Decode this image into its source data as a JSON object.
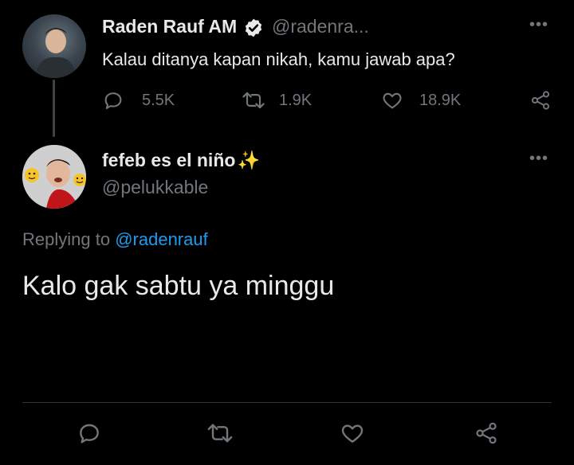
{
  "parent_tweet": {
    "display_name": "Raden Rauf AM",
    "handle": "@radenra...",
    "text": "Kalau ditanya kapan nikah, kamu jawab apa?",
    "replies": "5.5K",
    "retweets": "1.9K",
    "likes": "18.9K",
    "verified": true
  },
  "reply_tweet": {
    "display_name": "fefeb es el niño",
    "name_emoji": "✨",
    "handle": "@pelukkable",
    "replying_prefix": "Replying to",
    "replying_to": "@radenrauf",
    "text": "Kalo gak sabtu ya minggu"
  },
  "icons": {
    "reply": "reply-icon",
    "retweet": "retweet-icon",
    "like": "heart-icon",
    "share": "share-icon",
    "more": "more-icon",
    "verified": "verified-badge-icon"
  },
  "colors": {
    "background": "#000000",
    "text": "#e7e9ea",
    "muted": "#71767b",
    "link": "#1d9bf0"
  }
}
